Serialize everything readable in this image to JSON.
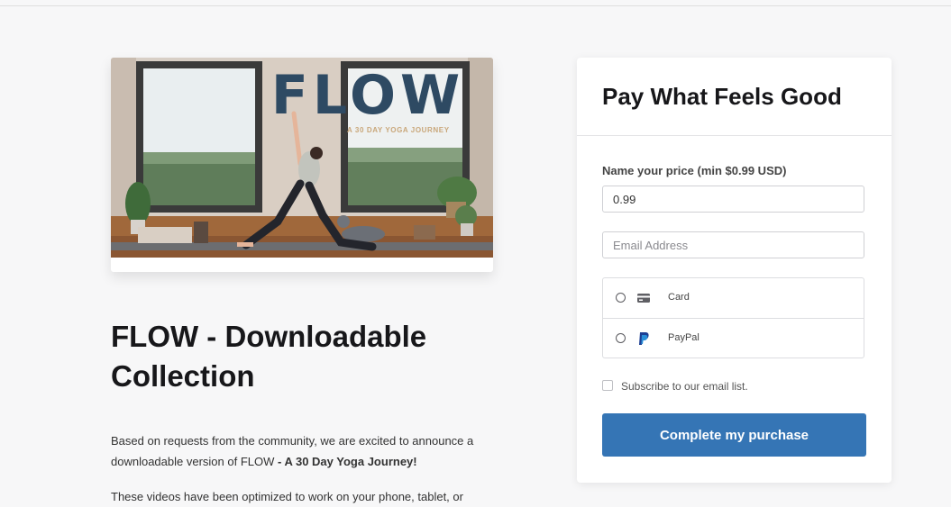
{
  "product": {
    "image": {
      "title": "FLOW",
      "subtitle": "A 30 DAY YOGA JOURNEY"
    },
    "title": "FLOW - Downloadable Collection",
    "description": {
      "intro": "Based on requests from the community, we are excited to announce a downloadable version of FLOW",
      "emphasis": "- A 30 Day Yoga Journey!",
      "second": "These videos have been optimized to work on your phone, tablet, or"
    }
  },
  "checkout": {
    "title": "Pay What Feels Good",
    "price_label": "Name your price (min $0.99 USD)",
    "price_value": "0.99",
    "email_placeholder": "Email Address",
    "payment_methods": [
      {
        "label": "Card",
        "icon": "card-icon"
      },
      {
        "label": "PayPal",
        "icon": "paypal-icon"
      }
    ],
    "subscribe_label": "Subscribe to our email list.",
    "submit_label": "Complete my purchase"
  },
  "colors": {
    "accent": "#3575b5",
    "flow_title": "#2e4a63",
    "flow_subtitle": "#c9a77a"
  }
}
